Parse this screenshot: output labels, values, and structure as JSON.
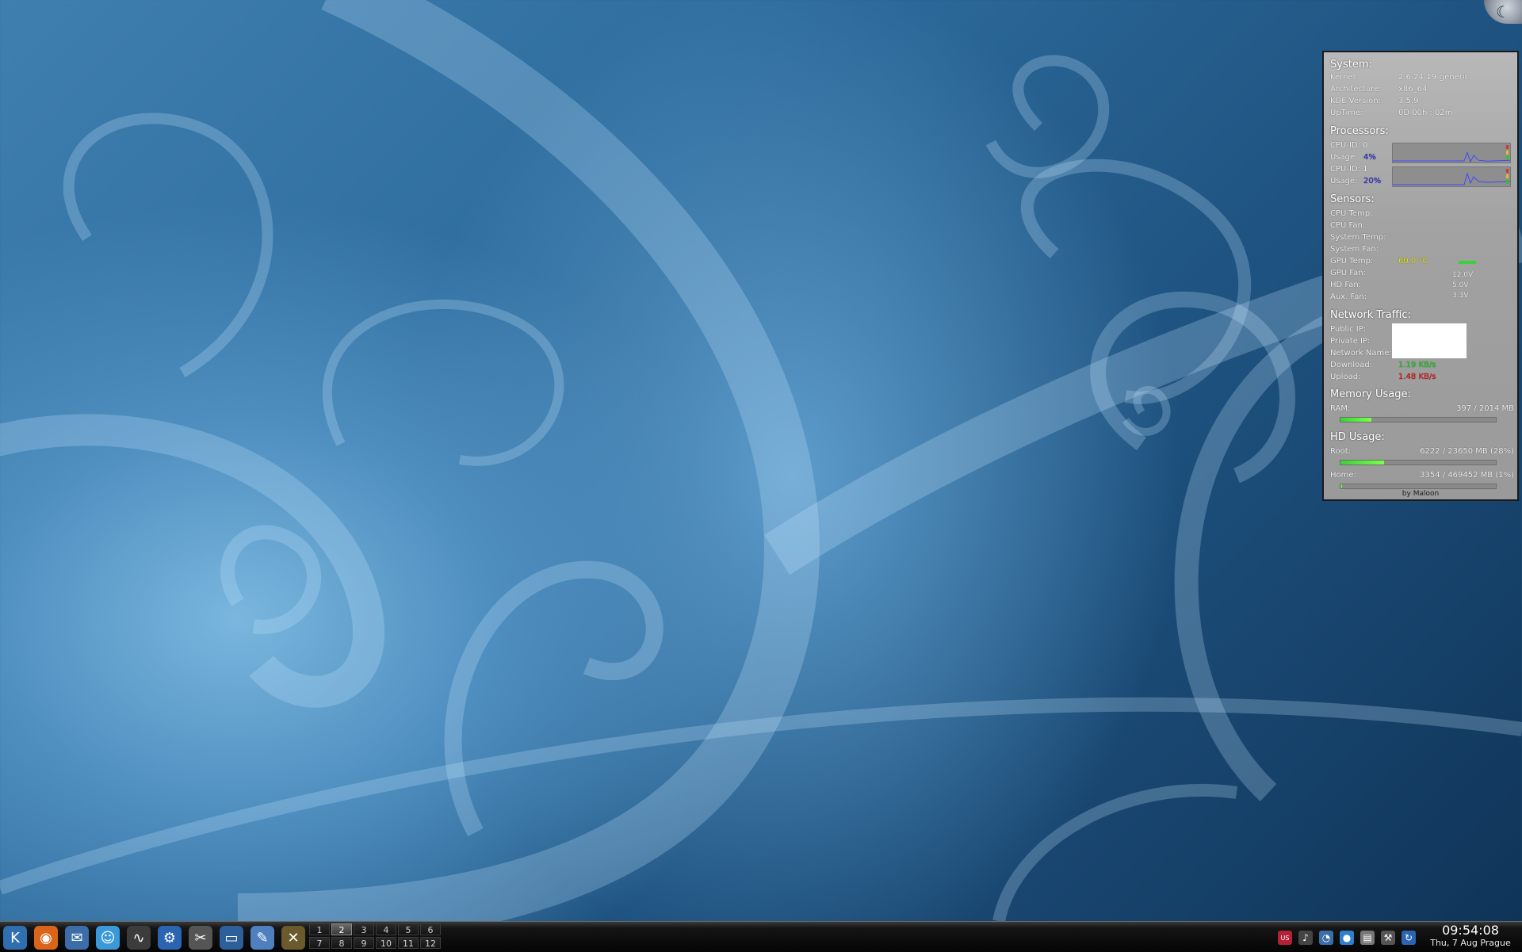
{
  "corner_widget": {
    "icon": "moon-logo-icon",
    "glyph": "☾"
  },
  "sysmon": {
    "system": {
      "title": "System:",
      "rows": [
        {
          "label": "Kernel:",
          "value": "2.6.24-19-generic"
        },
        {
          "label": "Architecture:",
          "value": "x86_64"
        },
        {
          "label": "KDE Version:",
          "value": "3.5.9"
        },
        {
          "label": "UpTime:",
          "value": "0D 00h : 02m"
        }
      ]
    },
    "processors": {
      "title": "Processors:",
      "cpus": [
        {
          "id_label": "CPU-ID: 0",
          "usage_label": "Usage:",
          "usage_value": "4%",
          "usage_fraction": 0.04
        },
        {
          "id_label": "CPU-ID: 1",
          "usage_label": "Usage:",
          "usage_value": "20%",
          "usage_fraction": 0.2
        }
      ],
      "usage_color": "#2a2adf",
      "graph_line_color": "#3d48ff"
    },
    "sensors": {
      "title": "Sensors:",
      "rows": [
        {
          "label": "CPU Temp:",
          "value": ""
        },
        {
          "label": "CPU Fan:",
          "value": ""
        },
        {
          "label": "System Temp:",
          "value": ""
        },
        {
          "label": "System Fan:",
          "value": ""
        },
        {
          "label": "GPU Temp:",
          "value": "60.0 °C"
        },
        {
          "label": "GPU Fan:",
          "value": ""
        },
        {
          "label": "HD Fan:",
          "value": ""
        },
        {
          "label": "Aux. Fan:",
          "value": ""
        }
      ],
      "gpu_temp_color": "#e6e600",
      "voltages": [
        "12.0V",
        "5.0V",
        "3.3V"
      ]
    },
    "network": {
      "title": "Network Traffic:",
      "rows": [
        {
          "label": "Public IP:",
          "value": ""
        },
        {
          "label": "Private IP:",
          "value": ""
        },
        {
          "label": "Network Name:",
          "value": ""
        },
        {
          "label": "Download:",
          "value": "1.19 KB/s"
        },
        {
          "label": "Upload:",
          "value": "1.48 KB/s"
        }
      ],
      "download_color": "#19d119",
      "upload_color": "#e01010"
    },
    "memory": {
      "title": "Memory Usage:",
      "ram_label": "RAM:",
      "ram_value": "397  /  2014 MB",
      "ram_fraction": 0.197
    },
    "hd": {
      "title": "HD Usage:",
      "root_label": "Root:",
      "root_value": "6222 / 23650 MB  (28%)",
      "root_fraction": 0.28,
      "home_label": "Home:",
      "home_value": "3354 / 469452 MB  (1%)",
      "home_fraction": 0.01
    },
    "footer": "by Maloon"
  },
  "taskbar": {
    "launchers": [
      {
        "name": "kde-menu-icon",
        "glyph": "K",
        "bg": "#2f6fb0"
      },
      {
        "name": "firefox-icon",
        "glyph": "◉",
        "bg": "#d9651b"
      },
      {
        "name": "thunderbird-icon",
        "glyph": "✉",
        "bg": "#3b6ea8"
      },
      {
        "name": "kopete-icon",
        "glyph": "☺",
        "bg": "#3a9ad9"
      },
      {
        "name": "ksysguard-icon",
        "glyph": "∿",
        "bg": "#3c3c3c"
      },
      {
        "name": "konqueror-icon",
        "glyph": "⚙",
        "bg": "#2b64b0"
      },
      {
        "name": "video-editor-icon",
        "glyph": "✂",
        "bg": "#555555"
      },
      {
        "name": "desktop-icon",
        "glyph": "▭",
        "bg": "#2d5f9a"
      },
      {
        "name": "text-editor-icon",
        "glyph": "✎",
        "bg": "#4f7fbf"
      },
      {
        "name": "terminal-icon",
        "glyph": "✕",
        "bg": "#6b5a2e"
      }
    ],
    "pager": [
      "1",
      "2",
      "3",
      "4",
      "5",
      "6",
      "7",
      "8",
      "9",
      "10",
      "11",
      "12"
    ],
    "active_desktop": "2",
    "tray": [
      {
        "name": "us-flag-icon",
        "glyph": "US",
        "bg": "#b22234"
      },
      {
        "name": "volume-icon",
        "glyph": "♪",
        "bg": "#444444"
      },
      {
        "name": "network-icon",
        "glyph": "◔",
        "bg": "#3b6ea8"
      },
      {
        "name": "kopete-tray-icon",
        "glyph": "●",
        "bg": "#2f7fd0"
      },
      {
        "name": "clipboard-icon",
        "glyph": "▤",
        "bg": "#777777"
      },
      {
        "name": "tools-icon",
        "glyph": "⚒",
        "bg": "#555555"
      },
      {
        "name": "update-icon",
        "glyph": "↻",
        "bg": "#2b64b0"
      }
    ],
    "clock_time": "09:54:08",
    "clock_date": "Thu, 7 Aug Prague"
  }
}
